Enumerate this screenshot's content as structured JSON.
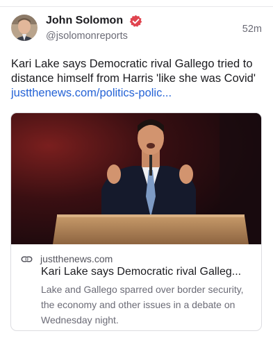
{
  "post": {
    "author_name": "John Solomon",
    "author_handle": "@jsolomonreports",
    "timestamp": "52m",
    "verified": true,
    "text": "Kari Lake says Democratic rival Gallego tried to distance himself from Harris 'like she was Covid'",
    "link_text": "justthenews.com/politics-polic..."
  },
  "card": {
    "domain": "justthenews.com",
    "title": "Kari Lake says Democratic rival Galleg...",
    "description": "Lake and Gallego sparred over border security, the economy and other issues in a debate on Wednesday night."
  },
  "colors": {
    "accent_link": "#2563d6",
    "verified_badge": "#e0444f"
  },
  "icons": {
    "verified": "verified-badge-icon",
    "link": "link-icon"
  }
}
